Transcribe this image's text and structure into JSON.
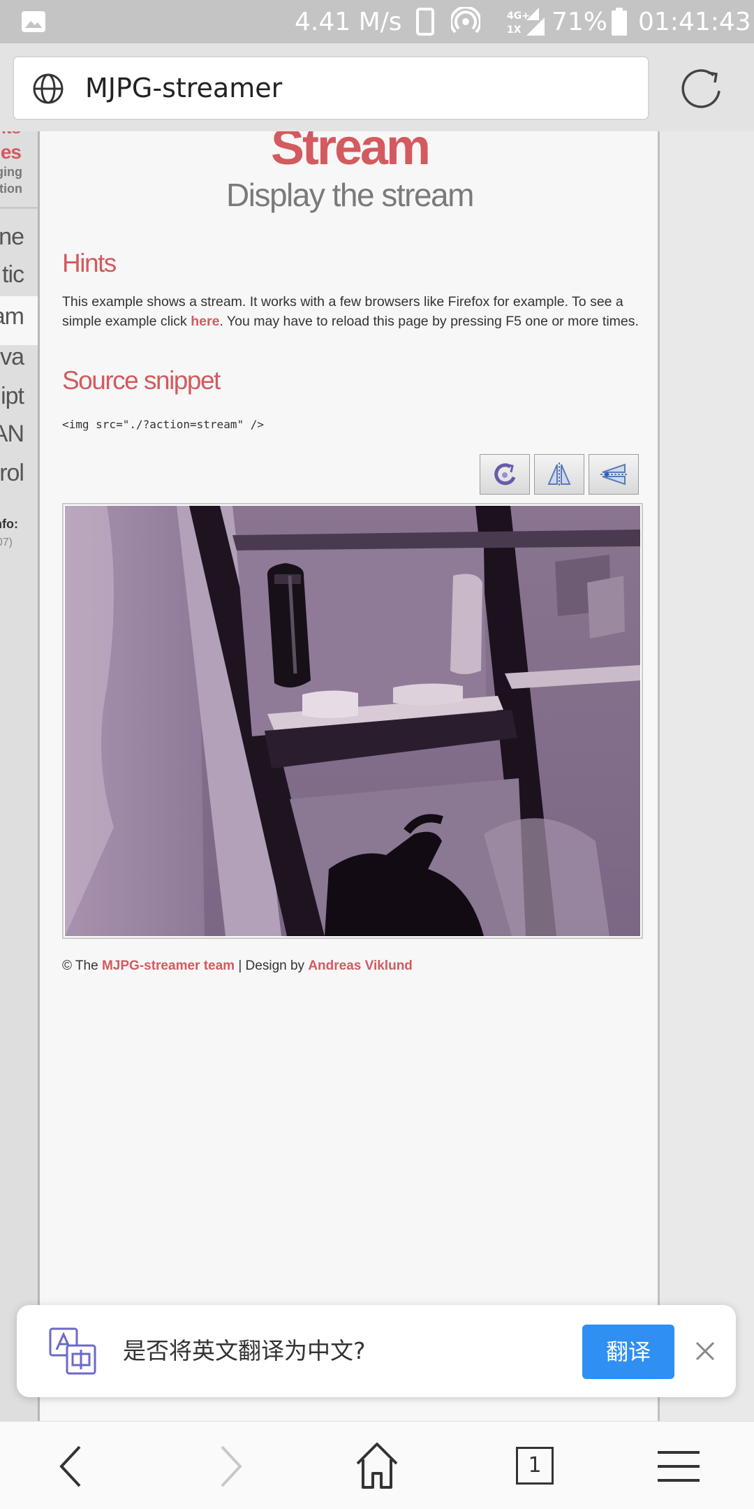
{
  "status_bar": {
    "speed": "4.41 M/s",
    "network_top": "4G+",
    "network_bottom": "1X",
    "battery": "71%",
    "time": "01:41:43",
    "icons": [
      "gallery-icon",
      "phone-icon",
      "hotspot-icon",
      "signal-icon",
      "battery-icon"
    ]
  },
  "browser": {
    "url_title": "MJPG-streamer",
    "icons": [
      "globe-icon",
      "reload-icon"
    ]
  },
  "left_nav": {
    "items_red": [
      "nts",
      "ges"
    ],
    "sub_items": [
      "ging",
      "ation"
    ],
    "items": [
      "ne",
      "tic",
      "am",
      "va",
      "ipt",
      "AN",
      "rol"
    ],
    "active_item": "am",
    "info_heading": "nfo:",
    "info_value": "07)"
  },
  "page": {
    "title": "Stream",
    "subtitle": "Display the stream",
    "hints_heading": "Hints",
    "hints_text_before": "This example shows a stream. It works with a few browsers like Firefox for example. To see a simple example click ",
    "hints_link": "here",
    "hints_text_after": ". You may have to reload this page by pressing F5 one or more times.",
    "source_heading": "Source snippet",
    "code": "<img src=\"./?action=stream\" />",
    "tool_buttons": [
      "rotate-icon",
      "mirror-icon",
      "flip-icon"
    ],
    "footer_prefix": "© The ",
    "footer_link_team": "MJPG-streamer team",
    "footer_mid": " | Design by ",
    "footer_link_designer": "Andreas Viklund"
  },
  "translate_banner": {
    "question": "是否将英文翻译为中文?",
    "button": "翻译",
    "accent": "#2f8ff2"
  },
  "bottom_toolbar": {
    "tab_count": "1",
    "icons": [
      "back-icon",
      "forward-icon",
      "home-icon",
      "tabs-icon",
      "menu-icon"
    ]
  },
  "colors": {
    "heading_red": "#d35a5e",
    "status_bar": "#c4c4c4"
  }
}
